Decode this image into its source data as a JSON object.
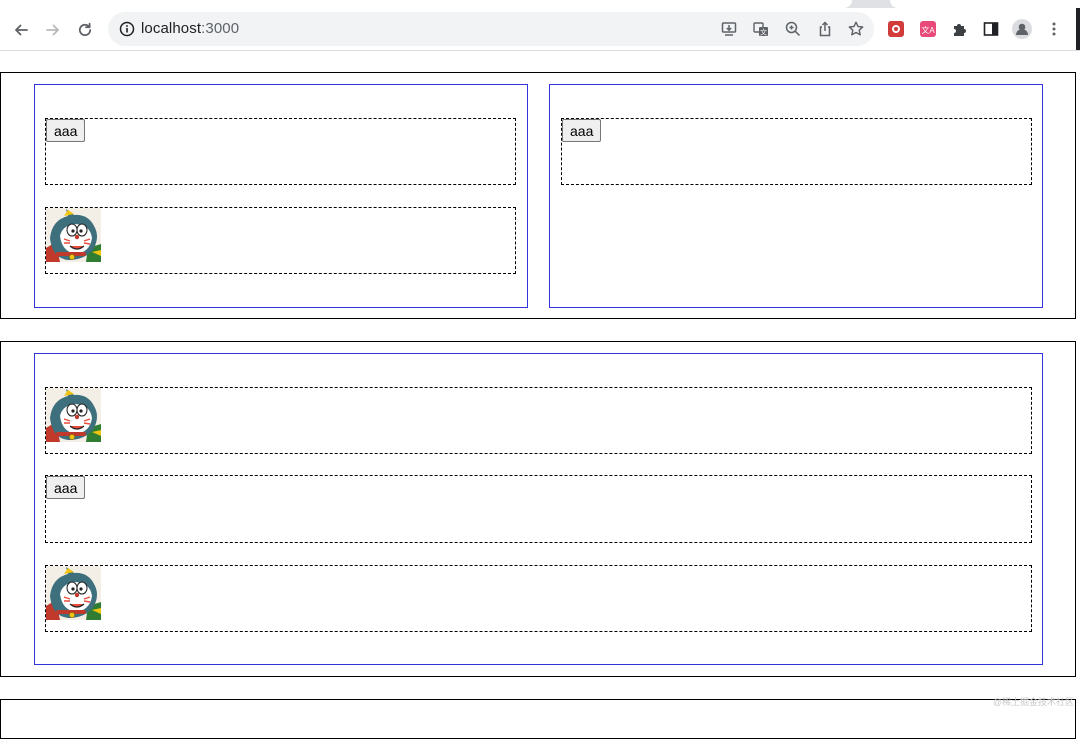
{
  "browser": {
    "url_host": "localhost",
    "url_port": ":3000",
    "nav": {
      "back_icon": "arrow-left-icon",
      "forward_icon": "arrow-right-icon",
      "reload_icon": "reload-icon"
    },
    "omnibox_icons": [
      "site-info-icon",
      "install-icon",
      "translate-icon",
      "zoom-icon",
      "share-icon",
      "bookmark-star-icon"
    ],
    "extension_icons": [
      "extension-red-icon",
      "extension-pink-icon",
      "puzzle-icon",
      "side-panel-icon",
      "profile-icon",
      "kebab-menu-icon"
    ]
  },
  "section1": {
    "left_column": {
      "cells": [
        {
          "type": "button",
          "label": "aaa"
        },
        {
          "type": "image",
          "alt": "cartoon cat avatar"
        }
      ]
    },
    "right_column": {
      "cells": [
        {
          "type": "button",
          "label": "aaa"
        }
      ]
    }
  },
  "section2": {
    "cells": [
      {
        "type": "image",
        "alt": "cartoon cat avatar"
      },
      {
        "type": "button",
        "label": "aaa"
      },
      {
        "type": "image",
        "alt": "cartoon cat avatar"
      }
    ]
  },
  "watermark": "@稀土掘金技术社区",
  "colors": {
    "column_border": "#3333dd",
    "row_border": "#000000",
    "omnibox_bg": "#f1f3f4"
  }
}
